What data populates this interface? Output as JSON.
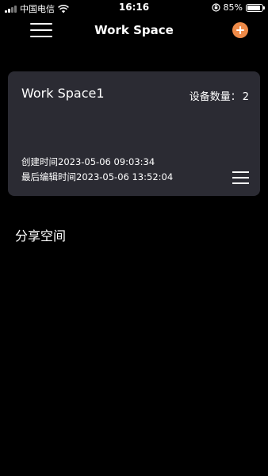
{
  "status_bar": {
    "carrier": "中国电信",
    "time": "16:16",
    "battery": "85%"
  },
  "nav": {
    "title": "Work Space"
  },
  "workspace_card": {
    "name": "Work Space1",
    "device_count_label": "设备数量：",
    "device_count": "2",
    "created_label": "创建时间",
    "created_time": "2023-05-06 09:03:34",
    "edited_label": "最后编辑时间",
    "edited_time": "2023-05-06 13:52:04"
  },
  "shared": {
    "heading": "分享空间"
  },
  "colors": {
    "accent": "#ee8a48",
    "card_bg": "#2b2b33",
    "page_bg": "#000000"
  }
}
